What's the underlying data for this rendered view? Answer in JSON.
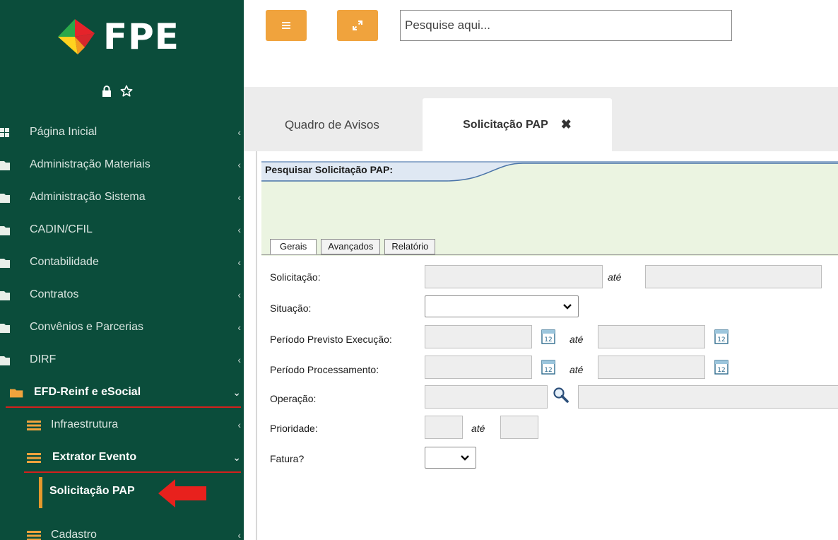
{
  "app": {
    "logo_text": "FPE"
  },
  "colors": {
    "sidebar_bg": "#0b4d3b",
    "accent_orange": "#f0a33d",
    "active_underline": "#d4201c",
    "form_header_bg": "#ebf4e1"
  },
  "topbar": {
    "menu_icon": "menu-icon",
    "expand_icon": "expand-icon",
    "search_placeholder": "Pesquise aqui..."
  },
  "sidebar": {
    "tools": [
      "lock-icon",
      "star-icon"
    ],
    "items": [
      {
        "label": "Página Inicial",
        "icon": "grid-icon"
      },
      {
        "label": "Administração Materiais",
        "icon": "folder-icon"
      },
      {
        "label": "Administração Sistema",
        "icon": "folder-icon"
      },
      {
        "label": "CADIN/CFIL",
        "icon": "folder-icon"
      },
      {
        "label": "Contabilidade",
        "icon": "folder-icon"
      },
      {
        "label": "Contratos",
        "icon": "folder-icon"
      },
      {
        "label": "Convênios e Parcerias",
        "icon": "folder-icon"
      },
      {
        "label": "DIRF",
        "icon": "folder-icon"
      },
      {
        "label": "EFD-Reinf e eSocial",
        "icon": "folder-open-icon",
        "expanded": true
      },
      {
        "label": "Infraestrutura",
        "icon": "list-icon"
      },
      {
        "label": "Extrator Evento",
        "icon": "list-icon",
        "expanded": true
      },
      {
        "label": "Solicitação PAP",
        "selected": true
      },
      {
        "label": "Cadastro",
        "icon": "list-icon"
      }
    ]
  },
  "tabs": [
    {
      "label": "Quadro de Avisos"
    },
    {
      "label": "Solicitação PAP",
      "active": true,
      "close": "✖"
    }
  ],
  "form": {
    "title": "Pesquisar Solicitação PAP:",
    "tabs": [
      "Gerais",
      "Avançados",
      "Relatório"
    ],
    "ate": "até",
    "fields": {
      "solicitacao": "Solicitação:",
      "situacao": "Situação:",
      "periodo_previsto": "Período Previsto Execução:",
      "periodo_processamento": "Período Processamento:",
      "operacao": "Operação:",
      "prioridade": "Prioridade:",
      "fatura": "Fatura?"
    }
  }
}
